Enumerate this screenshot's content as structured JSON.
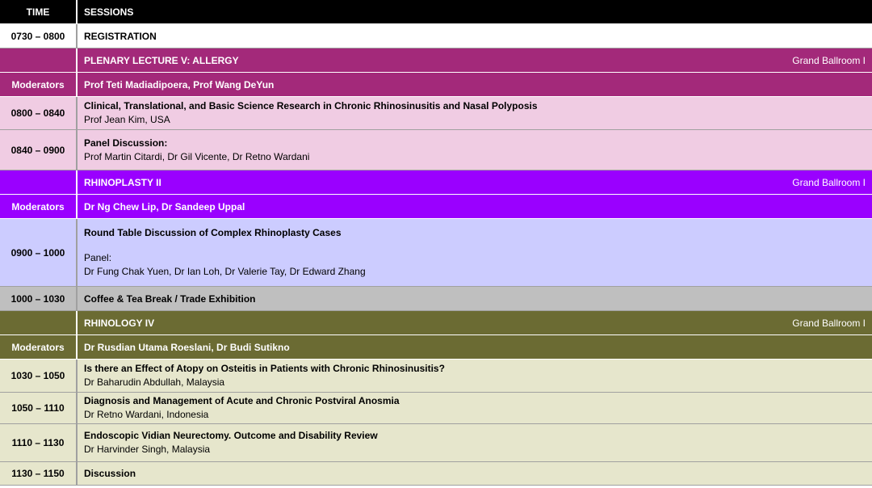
{
  "header": {
    "time": "TIME",
    "sessions": "SESSIONS"
  },
  "rows": [
    {
      "time": "0730 – 0800",
      "title": "REGISTRATION"
    },
    {
      "time": "",
      "title": "PLENARY LECTURE V: ALLERGY",
      "venue": "Grand Ballroom I"
    },
    {
      "time": "Moderators",
      "title": "Prof Teti Madiadipoera, Prof Wang DeYun"
    },
    {
      "time": "0800 – 0840",
      "title": "Clinical, Translational, and Basic Science Research in Chronic Rhinosinusitis and Nasal Polyposis",
      "speaker": "Prof Jean Kim, USA"
    },
    {
      "time": "0840 – 0900",
      "title": "Panel Discussion:",
      "speaker": "Prof Martin Citardi, Dr Gil Vicente, Dr Retno Wardani"
    },
    {
      "time": "",
      "title": "RHINOPLASTY II",
      "venue": "Grand Ballroom I"
    },
    {
      "time": "Moderators",
      "title": "Dr Ng Chew Lip, Dr Sandeep Uppal"
    },
    {
      "time": "0900 – 1000",
      "title": "Round Table Discussion of Complex Rhinoplasty Cases",
      "panel_label": "Panel:",
      "speaker": "Dr Fung Chak Yuen, Dr Ian Loh, Dr Valerie Tay, Dr Edward Zhang"
    },
    {
      "time": "1000 – 1030",
      "title": "Coffee & Tea Break / Trade Exhibition"
    },
    {
      "time": "",
      "title": "RHINOLOGY IV",
      "venue": "Grand Ballroom I"
    },
    {
      "time": "Moderators",
      "title": "Dr Rusdian Utama Roeslani, Dr Budi Sutikno"
    },
    {
      "time": "1030 – 1050",
      "title": "Is there an Effect of Atopy on Osteitis in Patients with Chronic Rhinosinusitis?",
      "speaker": "Dr Baharudin Abdullah, Malaysia"
    },
    {
      "time": "1050 – 1110",
      "title": "Diagnosis and Management of Acute and Chronic Postviral Anosmia",
      "speaker": "Dr Retno Wardani, Indonesia"
    },
    {
      "time": "1110 – 1130",
      "title": "Endoscopic Vidian Neurectomy.  Outcome and Disability Review",
      "speaker": "Dr Harvinder Singh, Malaysia"
    },
    {
      "time": "1130 – 1150",
      "title": "Discussion"
    }
  ],
  "colors": {
    "header": "#000000",
    "allergy": "#a3297a",
    "allergy_light": "#f0cce3",
    "rhinoplasty": "#9a00ff",
    "rhinoplasty_light": "#ccccff",
    "break": "#bfbfbf",
    "rhinology": "#6b6b33",
    "rhinology_light": "#e6e6cc"
  }
}
